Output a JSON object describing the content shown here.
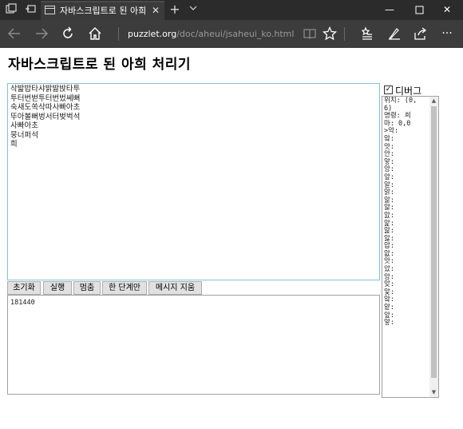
{
  "browser": {
    "tab_title": "자바스크립트로 된 아희",
    "url_host": "puzzlet.org",
    "url_path": "/doc/aheui/jsaheui_ko.html"
  },
  "page": {
    "title": "자바스크립트로 된 아희 처리기"
  },
  "code": {
    "lines": [
      "삭밟밥타샤밝밣밙타투",
      "투터번벋투터번벘쎄뻐",
      "숙새도쏙삭따사빠아초",
      "뚜아볼뻐벙서터벚벅석",
      "사빠아초",
      "뭉너퍼석",
      "희"
    ]
  },
  "controls": {
    "reset": "초기화",
    "run": "실행",
    "stop": "멈춤",
    "step": "한 단계만",
    "clear": "메시지 지움"
  },
  "output": {
    "text": "181440"
  },
  "debug": {
    "label": "디버그",
    "checked": true,
    "content": "위치: (0,\n6)\n명령: 희\n마: 0,0\n>악:\n앜:\n앗:\n안:\n앟:\n앙:\n앞:\n알:\n앍:\n앎:\n앏:\n앐:\n앑:\n앒:\n앓:\n압:\n앖:\n앗:\n았:\n앙:\n앚:\n앛:\n앜:\n앝:\n앞:\n앟:"
  },
  "icons": {
    "tab_list": "tabs-icon",
    "set_aside": "set-aside-icon",
    "back": "back-arrow-icon",
    "forward": "forward-arrow-icon",
    "refresh": "refresh-icon",
    "home": "home-icon",
    "reading_view": "reading-view-icon",
    "favorite": "star-icon",
    "hub": "hub-icon",
    "notes": "pen-icon",
    "share": "share-icon",
    "more": "more-icon"
  },
  "colors": {
    "chrome_dark": "#2b2b2b",
    "nav_bar": "#3c3c3c",
    "code_border": "#7ec3d8"
  }
}
